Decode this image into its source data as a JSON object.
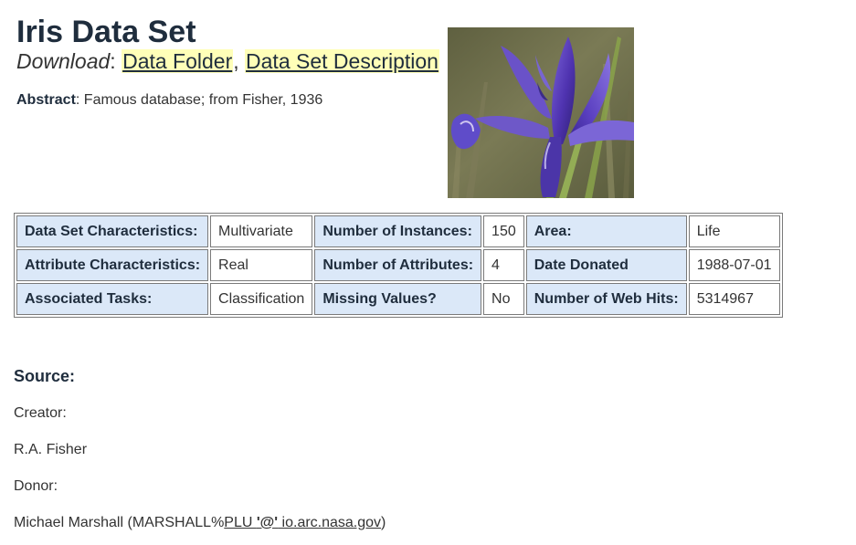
{
  "header": {
    "title": "Iris Data Set",
    "download_label": "Download",
    "download_colon": ": ",
    "link_separator": ", ",
    "links": [
      "Data Folder",
      "Data Set Description"
    ]
  },
  "abstract": {
    "label": "Abstract",
    "text": ": Famous database; from Fisher, 1936"
  },
  "photo": {
    "icon": "iris-flower-photo",
    "colors": {
      "petal": "#5b3fb8",
      "background": "#6a6a43",
      "stem": "#6f8a3a"
    }
  },
  "details_table": {
    "rows": [
      [
        {
          "label": "Data Set Characteristics:",
          "value": "Multivariate"
        },
        {
          "label": "Number of Instances:",
          "value": "150"
        },
        {
          "label": "Area:",
          "value": "Life"
        }
      ],
      [
        {
          "label": "Attribute Characteristics:",
          "value": "Real"
        },
        {
          "label": "Number of Attributes:",
          "value": "4"
        },
        {
          "label": "Date Donated",
          "value": "1988-07-01"
        }
      ],
      [
        {
          "label": "Associated Tasks:",
          "value": "Classification"
        },
        {
          "label": "Missing Values?",
          "value": "No"
        },
        {
          "label": "Number of Web Hits:",
          "value": "5314967"
        }
      ]
    ]
  },
  "source": {
    "heading": "Source:",
    "creator_label": "Creator:",
    "creator_name": "R.A. Fisher",
    "donor_label": "Donor:",
    "donor_name": "Michael Marshall (MARSHALL%",
    "donor_link_prefix": "PLU ",
    "donor_link_at": "'@'",
    "donor_link_domain": " io.arc.nasa.gov",
    "donor_suffix": ")"
  },
  "colors": {
    "heading": "#1f2d3d",
    "text": "#333333",
    "link_highlight": "#ffffb8",
    "key_cell_background": "#dbe8f8",
    "table_border": "#7a7a7a"
  }
}
